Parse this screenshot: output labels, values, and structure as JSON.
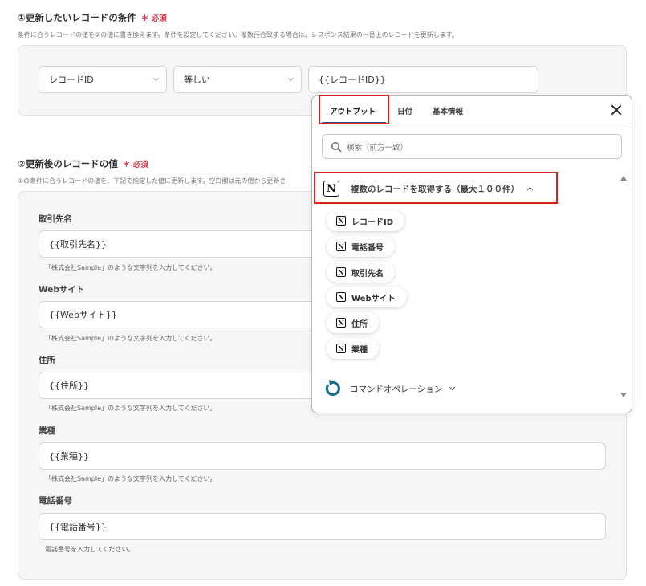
{
  "section1": {
    "title": "①更新したいレコードの条件",
    "required": "必須",
    "description": "条件に合うレコードの値を②の値に書き換えます。条件を設定してください。複数行合致する場合は、レスポンス結果の一番上のレコードを更新します。",
    "field_select": "レコードID",
    "operator_select": "等しい",
    "value": "{{レコードID}}"
  },
  "section2": {
    "title": "②更新後のレコードの値",
    "required": "必須",
    "description": "①の条件に合うレコードの値を、下記で指定した値に更新します。空白欄は元の値から更新さ",
    "fields": [
      {
        "label": "取引先名",
        "value": "{{取引先名}}",
        "hint": "「株式会社Sample」のような文字列を入力してください。"
      },
      {
        "label": "Webサイト",
        "value": "{{Webサイト}}",
        "hint": "「株式会社Sample」のような文字列を入力してください。"
      },
      {
        "label": "住所",
        "value": "{{住所}}",
        "hint": "「株式会社Sample」のような文字列を入力してください。"
      },
      {
        "label": "業種",
        "value": "{{業種}}",
        "hint": "「株式会社Sample」のような文字列を入力してください。"
      },
      {
        "label": "電話番号",
        "value": "{{電話番号}}",
        "hint": "電話番号を入力してください。"
      }
    ]
  },
  "popover": {
    "tabs": [
      {
        "label": "アウトプット"
      },
      {
        "label": "日付"
      },
      {
        "label": "基本情報"
      }
    ],
    "search_placeholder": "検索（前方一致）",
    "group_title": "複数のレコードを取得する（最大１００件）",
    "group_icon_letter": "N",
    "items": [
      {
        "label": "レコードID"
      },
      {
        "label": "電話番号"
      },
      {
        "label": "取引先名"
      },
      {
        "label": "Webサイト"
      },
      {
        "label": "住所"
      },
      {
        "label": "業種"
      }
    ],
    "command_label": "コマンドオペレーション"
  },
  "colors": {
    "required": "#e2344a",
    "highlight": "#d9211c",
    "tab_underline": "#2b5a8a",
    "command_icon": "#1d6e8a"
  }
}
